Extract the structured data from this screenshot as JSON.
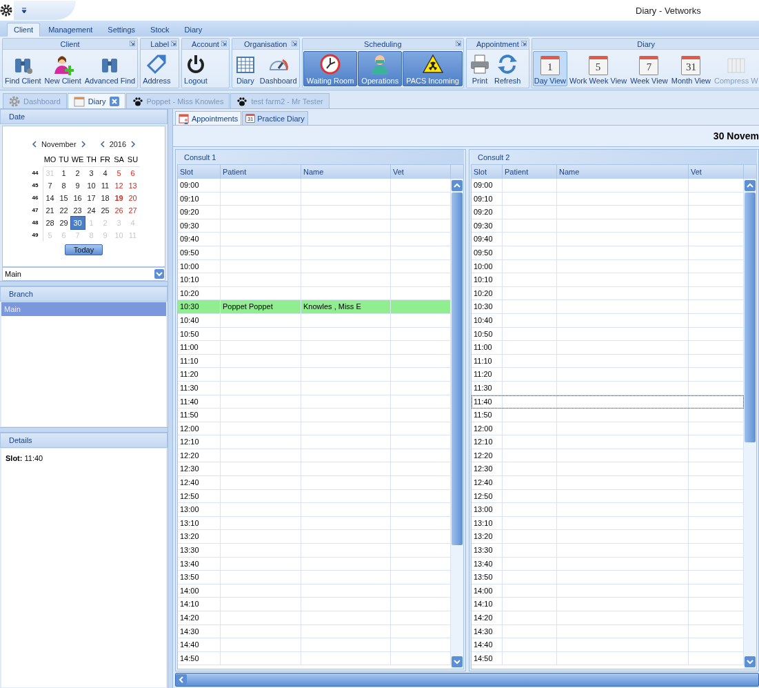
{
  "window": {
    "title": "Diary - Vetworks"
  },
  "ribbon_tabs": [
    {
      "label": "Client",
      "selected": true
    },
    {
      "label": "Management",
      "selected": false
    },
    {
      "label": "Settings",
      "selected": false
    },
    {
      "label": "Stock",
      "selected": false
    },
    {
      "label": "Diary",
      "selected": false
    }
  ],
  "ribbon_groups": [
    {
      "title": "Client",
      "launcher": true,
      "buttons": [
        {
          "label": "Find Client",
          "kind": "plain"
        },
        {
          "label": "New Client",
          "kind": "plain"
        },
        {
          "label": "Advanced Find",
          "kind": "plain"
        }
      ]
    },
    {
      "title": "Label",
      "launcher": true,
      "buttons": [
        {
          "label": "Address",
          "kind": "plain"
        }
      ]
    },
    {
      "title": "Account",
      "launcher": true,
      "buttons": [
        {
          "label": "Logout",
          "kind": "plain"
        }
      ]
    },
    {
      "title": "Organisation",
      "launcher": true,
      "buttons": [
        {
          "label": "Diary",
          "kind": "plain"
        },
        {
          "label": "Dashboard",
          "kind": "plain"
        }
      ]
    },
    {
      "title": "Scheduling",
      "launcher": true,
      "buttons": [
        {
          "label": "Waiting Room",
          "kind": "tile"
        },
        {
          "label": "Operations",
          "kind": "tile"
        },
        {
          "label": "PACS Incoming",
          "kind": "tile"
        }
      ]
    },
    {
      "title": "Appointment",
      "launcher": true,
      "buttons": [
        {
          "label": "Print",
          "kind": "plain"
        },
        {
          "label": "Refresh",
          "kind": "plain"
        }
      ]
    },
    {
      "title": "Diary",
      "launcher": false,
      "buttons": [
        {
          "label": "Day View",
          "kind": "calendar",
          "badge": "1",
          "selected": true,
          "disabled": false
        },
        {
          "label": "Work Week View",
          "kind": "calendar",
          "badge": "5",
          "selected": false,
          "disabled": false
        },
        {
          "label": "Week View",
          "kind": "calendar",
          "badge": "7",
          "selected": false,
          "disabled": false
        },
        {
          "label": "Month View",
          "kind": "calendar",
          "badge": "31",
          "selected": false,
          "disabled": false
        },
        {
          "label": "Compress W",
          "kind": "plain",
          "selected": false,
          "disabled": true
        }
      ]
    }
  ],
  "document_tabs": [
    {
      "label": "Dashboard",
      "kind": "dashboard",
      "selected": false
    },
    {
      "label": "Diary",
      "kind": "diary",
      "selected": true
    },
    {
      "label": "Poppet - Miss Knowles",
      "kind": "patient",
      "selected": false
    },
    {
      "label": "test farm2 -  Mr Tester",
      "kind": "patient",
      "selected": false
    }
  ],
  "date_panel": {
    "title": "Date",
    "month": "November",
    "year": "2016",
    "weekdays": [
      "MO",
      "TU",
      "WE",
      "TH",
      "FR",
      "SA",
      "SU"
    ],
    "weeks": [
      {
        "number": "44",
        "days": [
          {
            "d": "31",
            "kind": "other",
            "selected": false
          },
          {
            "d": "1",
            "kind": "day",
            "selected": false
          },
          {
            "d": "2",
            "kind": "day",
            "selected": false
          },
          {
            "d": "3",
            "kind": "day",
            "selected": false
          },
          {
            "d": "4",
            "kind": "day",
            "selected": false
          },
          {
            "d": "5",
            "kind": "weekend",
            "selected": false
          },
          {
            "d": "6",
            "kind": "weekend",
            "selected": false
          }
        ]
      },
      {
        "number": "45",
        "days": [
          {
            "d": "7",
            "kind": "day",
            "selected": false
          },
          {
            "d": "8",
            "kind": "day",
            "selected": false
          },
          {
            "d": "9",
            "kind": "day",
            "selected": false
          },
          {
            "d": "10",
            "kind": "day",
            "selected": false
          },
          {
            "d": "11",
            "kind": "day",
            "selected": false
          },
          {
            "d": "12",
            "kind": "weekend",
            "selected": false
          },
          {
            "d": "13",
            "kind": "weekend",
            "selected": false
          }
        ]
      },
      {
        "number": "46",
        "days": [
          {
            "d": "14",
            "kind": "day",
            "selected": false
          },
          {
            "d": "15",
            "kind": "day",
            "selected": false
          },
          {
            "d": "16",
            "kind": "day",
            "selected": false
          },
          {
            "d": "17",
            "kind": "day",
            "selected": false
          },
          {
            "d": "18",
            "kind": "day",
            "selected": false
          },
          {
            "d": "19",
            "kind": "marked",
            "selected": false
          },
          {
            "d": "20",
            "kind": "weekend",
            "selected": false
          }
        ]
      },
      {
        "number": "47",
        "days": [
          {
            "d": "21",
            "kind": "day",
            "selected": false
          },
          {
            "d": "22",
            "kind": "day",
            "selected": false
          },
          {
            "d": "23",
            "kind": "day",
            "selected": false
          },
          {
            "d": "24",
            "kind": "day",
            "selected": false
          },
          {
            "d": "25",
            "kind": "day",
            "selected": false
          },
          {
            "d": "26",
            "kind": "weekend",
            "selected": false
          },
          {
            "d": "27",
            "kind": "weekend",
            "selected": false
          }
        ]
      },
      {
        "number": "48",
        "days": [
          {
            "d": "28",
            "kind": "day",
            "selected": false
          },
          {
            "d": "29",
            "kind": "day",
            "selected": false
          },
          {
            "d": "30",
            "kind": "day",
            "selected": true
          },
          {
            "d": "1",
            "kind": "other",
            "selected": false
          },
          {
            "d": "2",
            "kind": "other",
            "selected": false
          },
          {
            "d": "3",
            "kind": "other",
            "selected": false
          },
          {
            "d": "4",
            "kind": "other",
            "selected": false
          }
        ]
      },
      {
        "number": "49",
        "days": [
          {
            "d": "5",
            "kind": "other",
            "selected": false
          },
          {
            "d": "6",
            "kind": "other",
            "selected": false
          },
          {
            "d": "7",
            "kind": "other",
            "selected": false
          },
          {
            "d": "8",
            "kind": "other",
            "selected": false
          },
          {
            "d": "9",
            "kind": "other",
            "selected": false
          },
          {
            "d": "10",
            "kind": "other",
            "selected": false
          },
          {
            "d": "11",
            "kind": "other",
            "selected": false
          }
        ]
      }
    ],
    "today_button": "Today",
    "diary_select": "Main"
  },
  "branch_panel": {
    "title": "Branch",
    "items": [
      {
        "label": "Main",
        "selected": true
      }
    ]
  },
  "details_panel": {
    "title": "Details",
    "text": "**Slot:** 11:40"
  },
  "sub_tabs": [
    {
      "label": "Appointments",
      "kind": "appointments",
      "selected": true
    },
    {
      "label": "Practice Diary",
      "kind": "calendar",
      "badge": "31",
      "selected": false
    }
  ],
  "date_heading": "30 Novem",
  "grids": [
    {
      "title": "Consult 1",
      "columns": [
        "Slot",
        "Patient",
        "Name",
        "Vet"
      ],
      "rows": [
        {
          "slot": "09:00",
          "selected": false
        },
        {
          "slot": "09:10",
          "selected": false
        },
        {
          "slot": "09:20",
          "selected": false
        },
        {
          "slot": "09:30",
          "selected": false
        },
        {
          "slot": "09:40",
          "selected": false
        },
        {
          "slot": "09:50",
          "selected": false
        },
        {
          "slot": "10:00",
          "selected": false
        },
        {
          "slot": "10:10",
          "selected": false
        },
        {
          "slot": "10:20",
          "selected": false
        },
        {
          "slot": "10:30",
          "patient": "Poppet Poppet",
          "name": "Knowles , Miss E",
          "color": "#90ee90",
          "selected": false
        },
        {
          "slot": "10:40",
          "selected": false
        },
        {
          "slot": "10:50",
          "selected": false
        },
        {
          "slot": "11:00",
          "selected": false
        },
        {
          "slot": "11:10",
          "selected": false
        },
        {
          "slot": "11:20",
          "selected": false
        },
        {
          "slot": "11:30",
          "selected": false
        },
        {
          "slot": "11:40",
          "selected": false
        },
        {
          "slot": "11:50",
          "selected": false
        },
        {
          "slot": "12:00",
          "selected": false
        },
        {
          "slot": "12:10",
          "selected": false
        },
        {
          "slot": "12:20",
          "selected": false
        },
        {
          "slot": "12:30",
          "selected": false
        },
        {
          "slot": "12:40",
          "selected": false
        },
        {
          "slot": "12:50",
          "selected": false
        },
        {
          "slot": "13:00",
          "selected": false
        },
        {
          "slot": "13:10",
          "selected": false
        },
        {
          "slot": "13:20",
          "selected": false
        },
        {
          "slot": "13:30",
          "selected": false
        },
        {
          "slot": "13:40",
          "selected": false
        },
        {
          "slot": "13:50",
          "selected": false
        },
        {
          "slot": "14:00",
          "selected": false
        },
        {
          "slot": "14:10",
          "selected": false
        },
        {
          "slot": "14:20",
          "selected": false
        },
        {
          "slot": "14:30",
          "selected": false
        },
        {
          "slot": "14:40",
          "selected": false
        },
        {
          "slot": "14:50",
          "selected": false
        }
      ]
    },
    {
      "title": "Consult 2",
      "columns": [
        "Slot",
        "Patient",
        "Name",
        "Vet"
      ],
      "rows": [
        {
          "slot": "09:00",
          "selected": false
        },
        {
          "slot": "09:10",
          "selected": false
        },
        {
          "slot": "09:20",
          "selected": false
        },
        {
          "slot": "09:30",
          "selected": false
        },
        {
          "slot": "09:40",
          "selected": false
        },
        {
          "slot": "09:50",
          "selected": false
        },
        {
          "slot": "10:00",
          "selected": false
        },
        {
          "slot": "10:10",
          "selected": false
        },
        {
          "slot": "10:20",
          "selected": false
        },
        {
          "slot": "10:30",
          "selected": false
        },
        {
          "slot": "10:40",
          "selected": false
        },
        {
          "slot": "10:50",
          "selected": false
        },
        {
          "slot": "11:00",
          "selected": false
        },
        {
          "slot": "11:10",
          "selected": false
        },
        {
          "slot": "11:20",
          "selected": false
        },
        {
          "slot": "11:30",
          "selected": false
        },
        {
          "slot": "11:40",
          "selected": true
        },
        {
          "slot": "11:50",
          "selected": false
        },
        {
          "slot": "12:00",
          "selected": false
        },
        {
          "slot": "12:10",
          "selected": false
        },
        {
          "slot": "12:20",
          "selected": false
        },
        {
          "slot": "12:30",
          "selected": false
        },
        {
          "slot": "12:40",
          "selected": false
        },
        {
          "slot": "12:50",
          "selected": false
        },
        {
          "slot": "13:00",
          "selected": false
        },
        {
          "slot": "13:10",
          "selected": false
        },
        {
          "slot": "13:20",
          "selected": false
        },
        {
          "slot": "13:30",
          "selected": false
        },
        {
          "slot": "13:40",
          "selected": false
        },
        {
          "slot": "13:50",
          "selected": false
        },
        {
          "slot": "14:00",
          "selected": false
        },
        {
          "slot": "14:10",
          "selected": false
        },
        {
          "slot": "14:20",
          "selected": false
        },
        {
          "slot": "14:30",
          "selected": false
        },
        {
          "slot": "14:40",
          "selected": false
        },
        {
          "slot": "14:50",
          "selected": false
        }
      ]
    }
  ]
}
